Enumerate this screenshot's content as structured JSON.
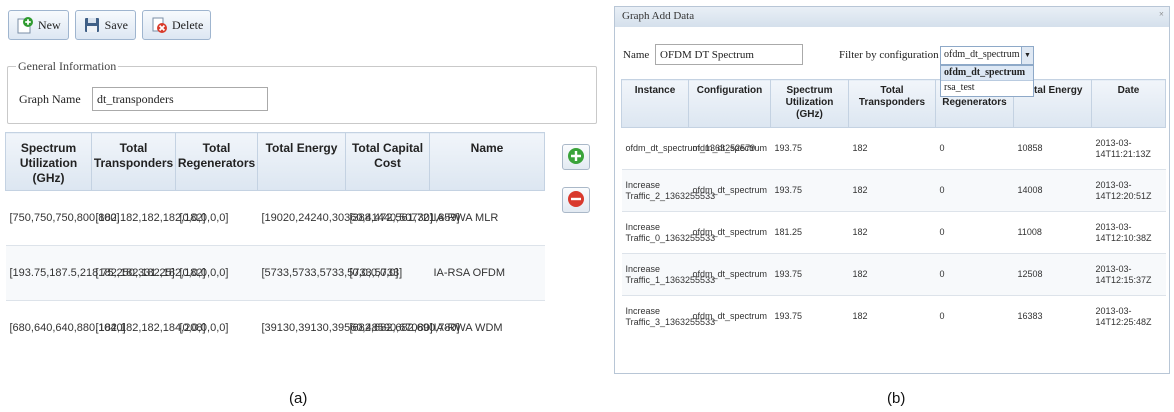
{
  "panel_a": {
    "toolbar": {
      "new_label": "New",
      "save_label": "Save",
      "delete_label": "Delete"
    },
    "general_info": {
      "legend": "General Information",
      "graph_name_label": "Graph Name",
      "graph_name_value": "dt_transponders"
    },
    "table": {
      "headers": [
        "Spectrum Utilization (GHz)",
        "Total Transponders",
        "Total Regenerators",
        "Total Energy",
        "Total Capital Cost",
        "Name"
      ],
      "rows": [
        [
          "[750,750,750,800,800]",
          "[182,182,182,182,182]",
          "[0,0,0,0,0]",
          "[19020,24240,30360,41440,50730]",
          "[388,472,561,721,859]",
          "IA-RWA MLR"
        ],
        [
          "[193.75,187.5,218.75,250,331.25]",
          "[182,182,182,182,182]",
          "[0,0,0,0,0]",
          "[5733,5733,5733,5733,5733]",
          "[0,0,0,0,0]",
          "IA-RSA OFDM"
        ],
        [
          "[680,640,640,880,1040]",
          "[182,182,182,184,208]",
          "[0,0,0,0,0]",
          "[39130,39130,39560,48590,67080]",
          "[682,682,682,690,780]",
          "IA-RWA WDM"
        ]
      ]
    },
    "caption": "(a)"
  },
  "panel_b": {
    "title": "Graph Add Data",
    "close_glyph": "×",
    "name_label": "Name",
    "name_value": "OFDM DT Spectrum",
    "filter_label": "Filter by configuration",
    "filter_selected": "ofdm_dt_spectrum",
    "filter_options": [
      "ofdm_dt_spectrum",
      "rsa_test"
    ],
    "table": {
      "headers": [
        "Instance",
        "Configuration",
        "Spectrum Utilization (GHz)",
        "Total Transponders",
        "Total Regenerators",
        "Total Energy",
        "Date"
      ],
      "rows": [
        [
          "ofdm_dt_spectrum_1363252579",
          "ofdm_dt_spectrum",
          "193.75",
          "182",
          "0",
          "10858",
          "2013-03-14T11:21:13Z"
        ],
        [
          "Increase Traffic_2_1363255533",
          "ofdm_dt_spectrum",
          "193.75",
          "182",
          "0",
          "14008",
          "2013-03-14T12:20:51Z"
        ],
        [
          "Increase Traffic_0_1363255533",
          "ofdm_dt_spectrum",
          "181.25",
          "182",
          "0",
          "11008",
          "2013-03-14T12:10:38Z"
        ],
        [
          "Increase Traffic_1_1363255533",
          "ofdm_dt_spectrum",
          "193.75",
          "182",
          "0",
          "12508",
          "2013-03-14T12:15:37Z"
        ],
        [
          "Increase Traffic_3_1363255533",
          "ofdm_dt_spectrum",
          "193.75",
          "182",
          "0",
          "16383",
          "2013-03-14T12:25:48Z"
        ]
      ]
    },
    "caption": "(b)"
  },
  "colors": {
    "header_bg": "#dce6f1",
    "add_green": "#3aa33a",
    "remove_red": "#d93a2e",
    "accent_border": "#9fb5cf"
  }
}
